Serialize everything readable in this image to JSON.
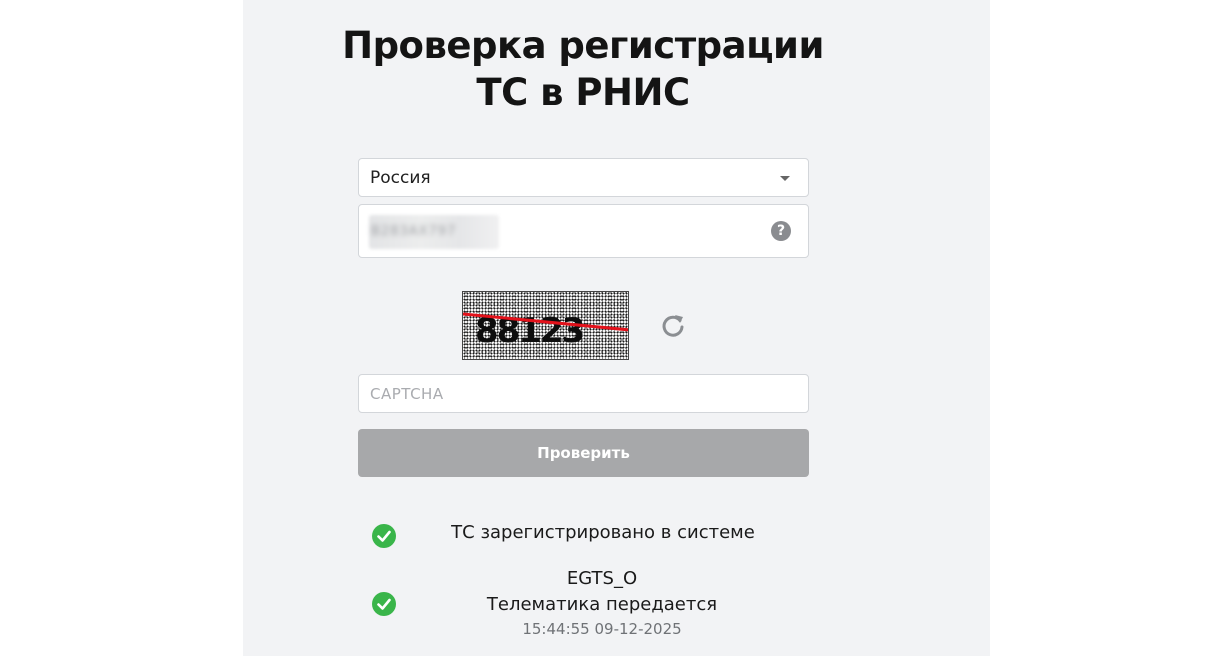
{
  "header": {
    "title_line1": "Проверка регистрации",
    "title_line2": "ТС в РНИС"
  },
  "form": {
    "country_select": {
      "value": "Россия"
    },
    "vehicle_number": {
      "value": "В283АХ797",
      "help_icon": "question-circle-icon"
    },
    "captcha": {
      "image_text": "88123",
      "refresh_icon": "refresh-icon",
      "placeholder": "CAPTCHA"
    },
    "submit_label": "Проверить"
  },
  "results": {
    "registration": {
      "icon": "check-circle-icon",
      "text": "ТС зарегистрировано в системе"
    },
    "telematics": {
      "icon": "check-circle-icon",
      "protocol": "EGTS_O",
      "text": "Телематика передается",
      "timestamp": "15:44:55 09-12-2025"
    }
  },
  "colors": {
    "success": "#3ab54a",
    "button_disabled": "#a7a8aa",
    "panel_bg": "#f2f3f5"
  }
}
